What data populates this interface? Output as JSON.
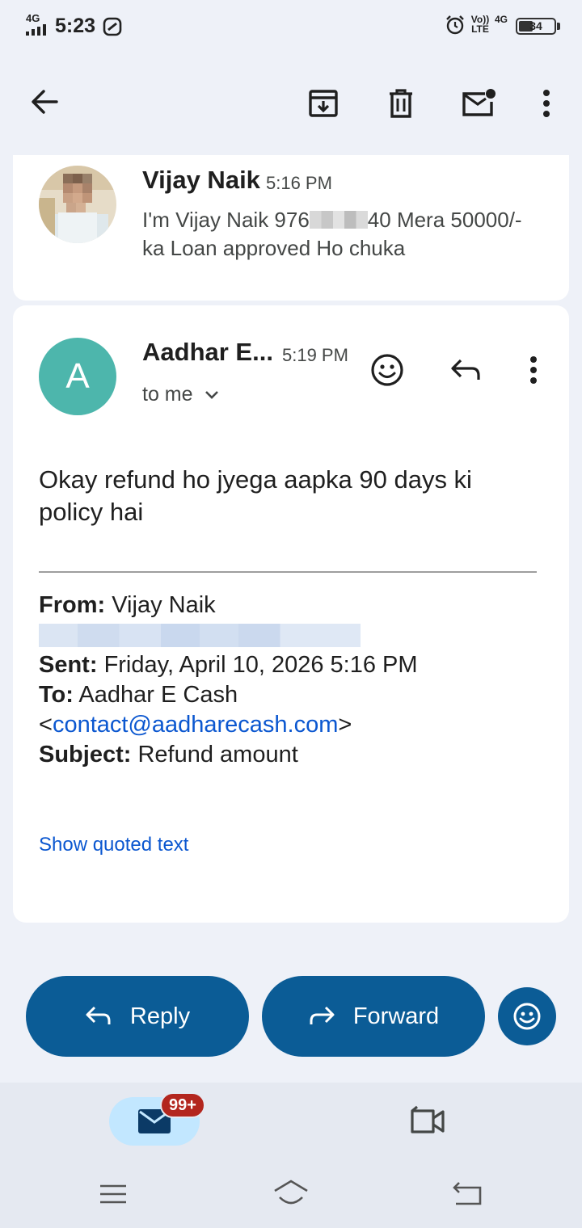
{
  "status_bar": {
    "network": "4G",
    "time": "5:23",
    "volte": "Vo)) LTE",
    "network2": "4G",
    "battery": "34"
  },
  "toolbar": {
    "back_icon": "arrow-left-icon",
    "archive_icon": "archive-icon",
    "delete_icon": "trash-icon",
    "mark_unread_icon": "mail-unread-icon",
    "more_icon": "more-vertical-icon"
  },
  "message1": {
    "sender": "Vijay Naik",
    "time": "5:16 PM",
    "snippet_part1": "I'm Vijay Naik 976",
    "snippet_part2": "40 Mera 50000/- ka Loan approved Ho chuka"
  },
  "message2": {
    "avatar_letter": "A",
    "avatar_color": "#4db6ac",
    "sender": "Aadhar E...",
    "time": "5:19 PM",
    "recipient": "to me",
    "body": "Okay refund ho jyega aapka 90 days ki policy hai",
    "quoted": {
      "from_label": "From:",
      "from_value": "Vijay Naik",
      "sent_label": "Sent:",
      "sent_value": "Friday, April 10, 2026 5:16 PM",
      "to_label": "To:",
      "to_value": "Aadhar E Cash",
      "to_email_open": "<",
      "to_email": "contact@aadharecash.com",
      "to_email_close": ">",
      "subject_label": "Subject:",
      "subject_value": "Refund amount"
    },
    "show_quoted": "Show quoted text"
  },
  "actions": {
    "reply": "Reply",
    "forward": "Forward"
  },
  "bottom_nav": {
    "mail_badge": "99+"
  },
  "colors": {
    "accent_button": "#0b5c96",
    "link": "#0b57d0",
    "badge": "#b3261e"
  }
}
